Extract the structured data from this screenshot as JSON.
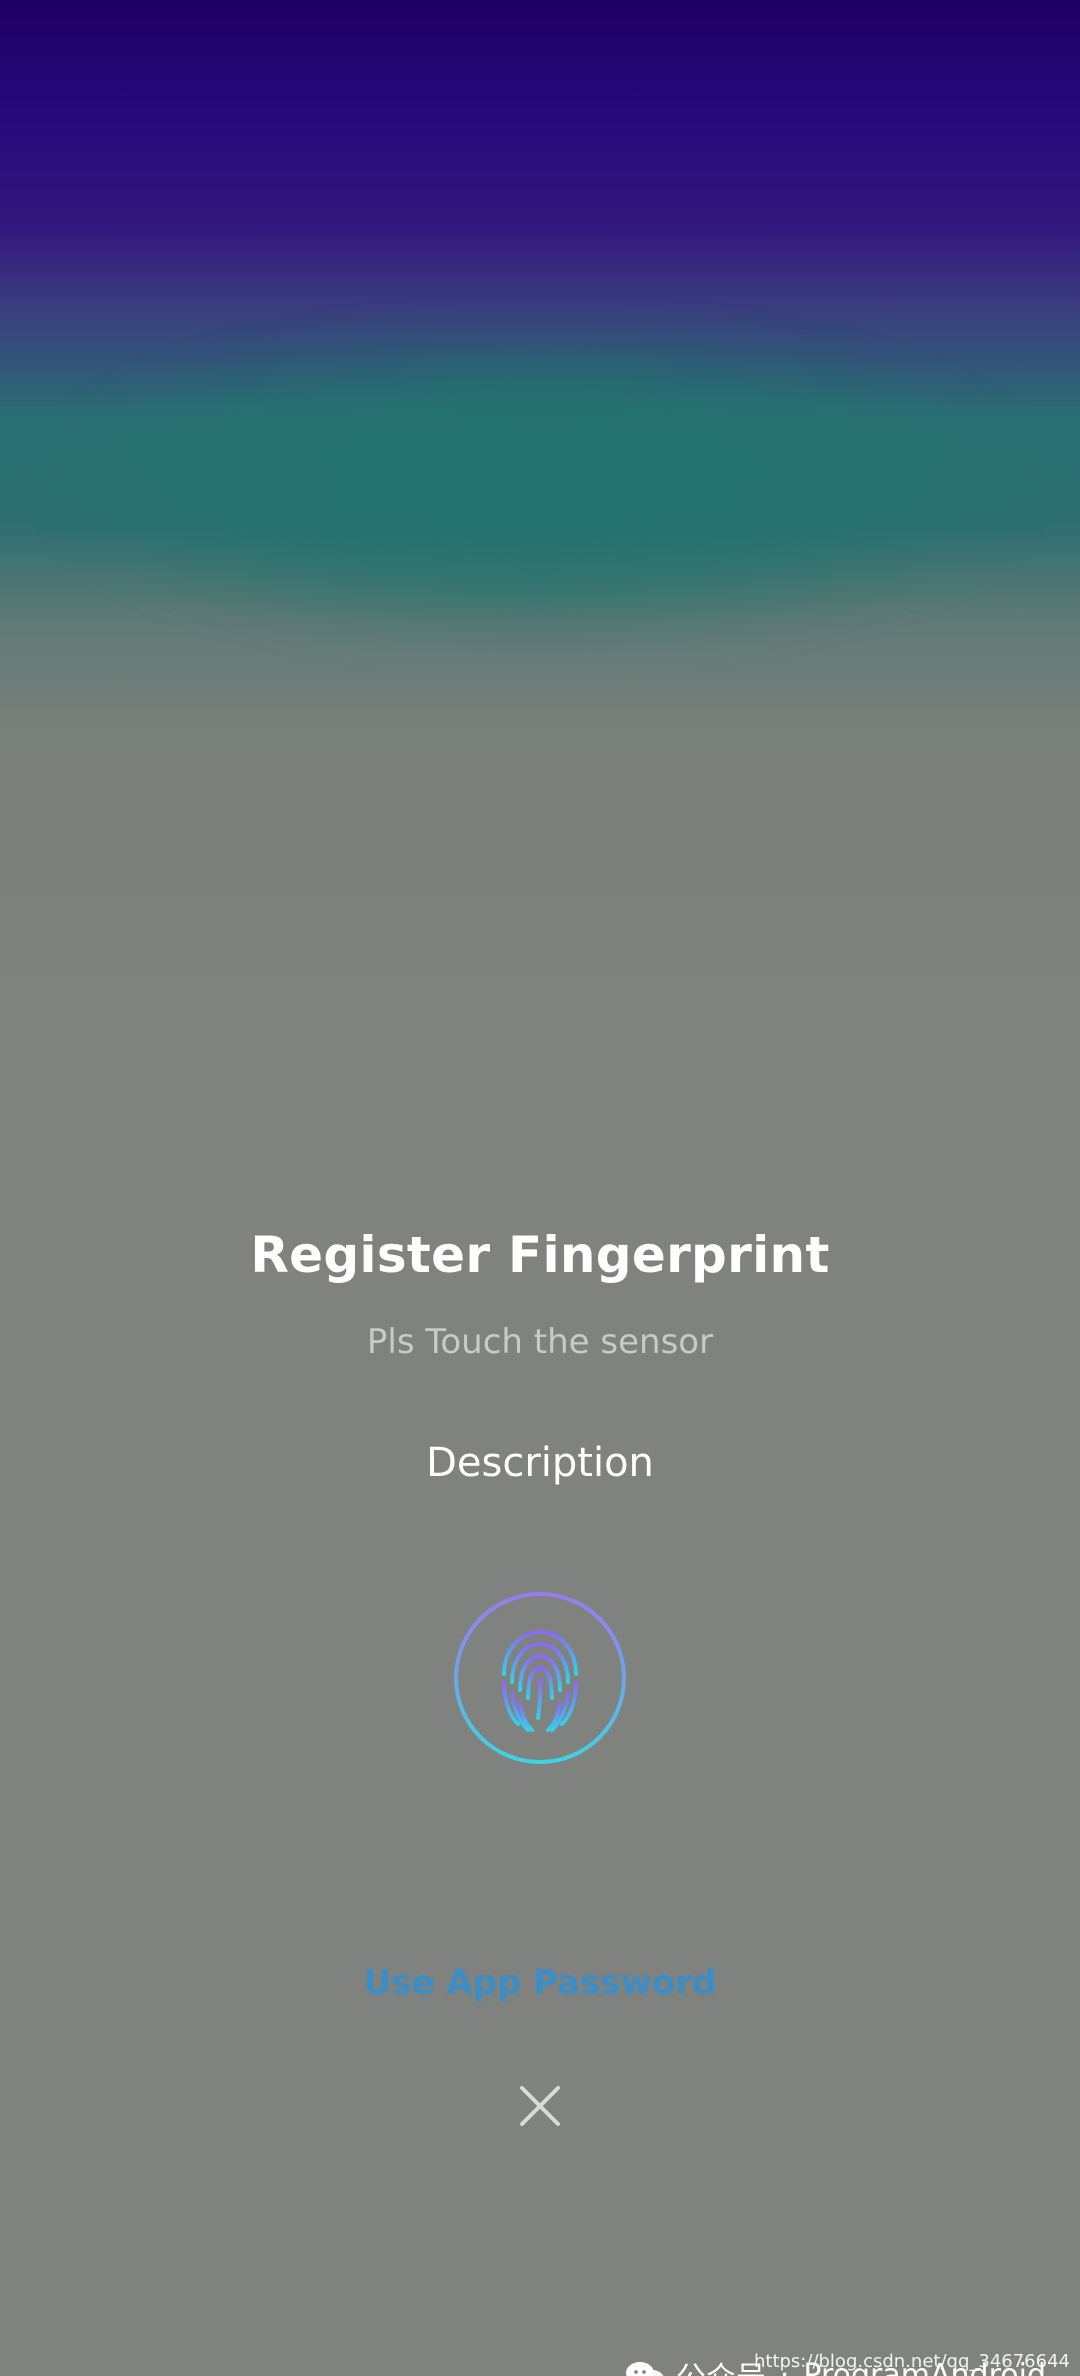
{
  "dialog": {
    "title": "Register Fingerprint",
    "subtitle": "Pls Touch the sensor",
    "description": "Description",
    "alt_action_label": "Use App Password",
    "close_icon": "close-icon",
    "fingerprint_icon": "fingerprint-icon"
  },
  "watermark": {
    "name": "公众号",
    "separator": "·",
    "account": "ProgramAndroid",
    "url": "https://blog.csdn.net/qq_34676644"
  },
  "colors": {
    "top_gradient": "#1e0063",
    "band_teal": "#2b6f6f",
    "overlay_gray": "#7f827e",
    "link_blue": "#2f8fd3",
    "fingerprint_purple": "#8a6bf0",
    "fingerprint_cyan": "#35d0e6"
  }
}
